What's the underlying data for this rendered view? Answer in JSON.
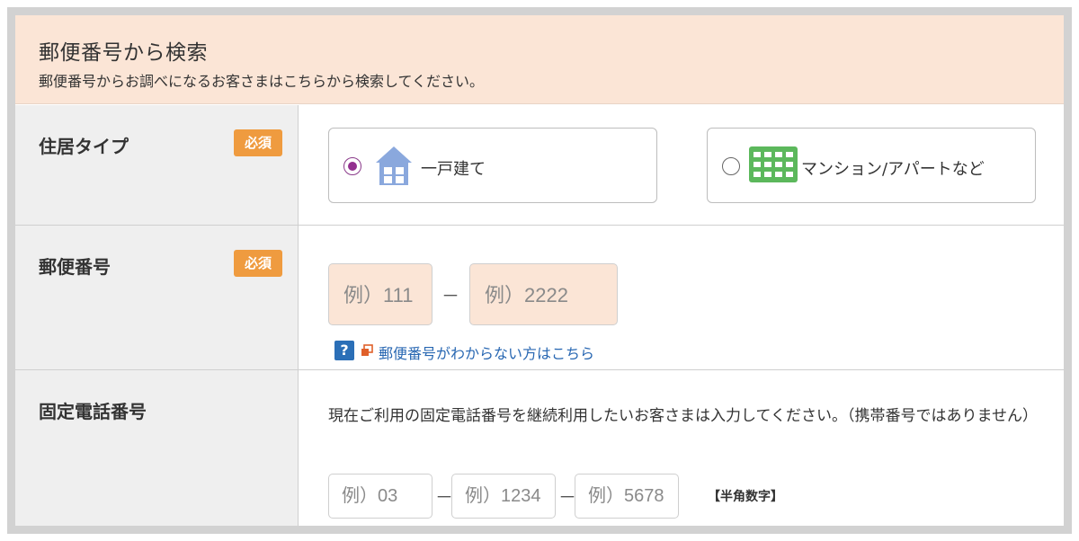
{
  "section": {
    "title": "郵便番号から検索",
    "subtitle": "郵便番号からお調べになるお客さまはこちらから検索してください。"
  },
  "required_badge": "必須",
  "residence": {
    "label": "住居タイプ",
    "options": [
      {
        "label": "一戸建て",
        "icon": "house-icon",
        "selected": true
      },
      {
        "label": "マンション/アパートなど",
        "icon": "apartment-building-icon",
        "selected": false
      }
    ]
  },
  "postal": {
    "label": "郵便番号",
    "part1_placeholder": "例）111",
    "part2_placeholder": "例）2222",
    "separator": "－",
    "help_link": "郵便番号がわからない方はこちら"
  },
  "phone": {
    "label": "固定電話番号",
    "note": "現在ご利用の固定電話番号を継続利用したいお客さまは入力してください。（携帯番号ではありません）",
    "part1_placeholder": "例）03",
    "part2_placeholder": "例）1234",
    "part3_placeholder": "例）5678",
    "separator": "－",
    "format_note": "【半角数字】"
  },
  "colors": {
    "header_bg": "#fbe5d6",
    "badge": "#ef9b3f",
    "radio_selected": "#93308f",
    "link": "#2867b2",
    "house_icon": "#8aa8dd",
    "building_icon": "#5cb85c"
  }
}
